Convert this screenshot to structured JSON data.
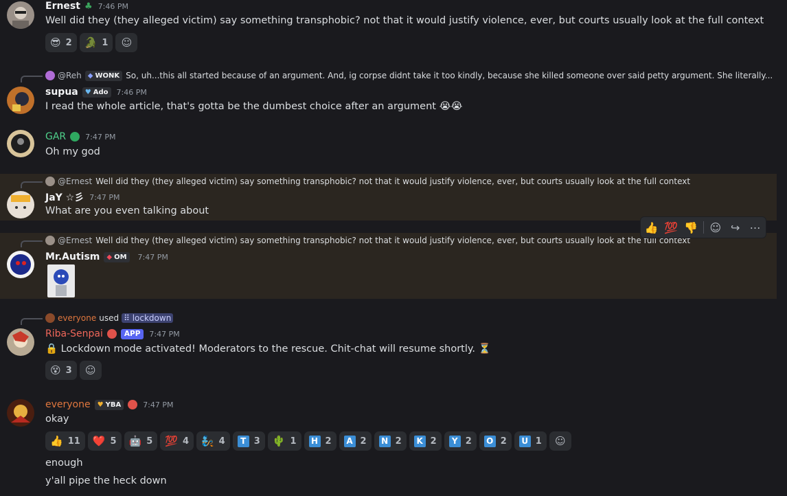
{
  "messages": [
    {
      "username": "Ernest",
      "timestamp": "7:46 PM",
      "text": "Well did they (they alleged victim) say something transphobic? not that it would justify violence, ever, but courts usually look at the full context",
      "reactions": [
        {
          "emoji": "😎",
          "count": "2"
        },
        {
          "emoji": "🐊",
          "count": "1"
        }
      ]
    },
    {
      "reply_name": "@Reh",
      "reply_tag": "WONK",
      "reply_text": "So, uh...this all started because of an argument. And, ig corpse didnt take it too kindly, because she killed someone over said petty argument. She literally...",
      "username": "supua",
      "tag": "Ado",
      "timestamp": "7:46 PM",
      "text": "I read the whole article, that's gotta be the dumbest choice after an argument 😭😭"
    },
    {
      "username": "GAR",
      "timestamp": "7:47 PM",
      "text": "Oh my god"
    },
    {
      "reply_name": "@Ernest",
      "reply_text": "Well did they (they alleged victim) say something transphobic? not that it would justify violence, ever, but courts usually look at the full context",
      "username": "JaY ☆彡",
      "timestamp": "7:47 PM",
      "text": "What are you even talking about"
    },
    {
      "reply_name": "@Ernest",
      "reply_text": "Well did they (they alleged victim) say something transphobic? not that it would justify violence, ever, but courts usually look at the full context",
      "username": "Mr.Autism",
      "tag": "OM",
      "timestamp": "7:47 PM"
    },
    {
      "reply_name": "everyone",
      "reply_used": "used",
      "reply_command": "lockdown",
      "username": "Riba-Senpai",
      "app_badge": "APP",
      "timestamp": "7:47 PM",
      "text": "🔒 Lockdown mode activated! Moderators to the rescue. Chit-chat will resume shortly. ⏳",
      "reactions": [
        {
          "emoji": "😵",
          "count": "3"
        }
      ]
    },
    {
      "username": "everyone",
      "tag": "YBA",
      "timestamp": "7:47 PM",
      "lines": [
        "okay",
        "enough",
        "y'all pipe the heck down"
      ],
      "reactions": [
        {
          "emoji": "👍",
          "count": "11"
        },
        {
          "emoji": "❤️",
          "count": "5"
        },
        {
          "emoji": "🤖",
          "count": "5"
        },
        {
          "emoji": "💯",
          "count": "4"
        },
        {
          "emoji": "🧞",
          "count": "4"
        },
        {
          "letter": "T",
          "count": "3"
        },
        {
          "emoji": "🌵",
          "count": "1"
        },
        {
          "letter": "H",
          "count": "2"
        },
        {
          "letter": "A",
          "count": "2"
        },
        {
          "letter": "N",
          "count": "2"
        },
        {
          "letter": "K",
          "count": "2"
        },
        {
          "letter": "Y",
          "count": "2"
        },
        {
          "letter": "O",
          "count": "2"
        },
        {
          "letter": "U",
          "count": "1"
        }
      ]
    }
  ],
  "hover_toolbar": {
    "emojis": [
      "👍",
      "💯",
      "👎"
    ],
    "icons": [
      "add-reaction-icon",
      "reply-icon",
      "more-icon"
    ]
  },
  "colors": {
    "background": "#1a1a1e",
    "highlight": "#2b2620",
    "reaction_bg": "#2b2d31",
    "gar": "#4fd18b",
    "riba": "#f0675a",
    "everyone": "#e0773e",
    "app_badge": "#5865f2",
    "letter_box": "#3b8ed6"
  }
}
